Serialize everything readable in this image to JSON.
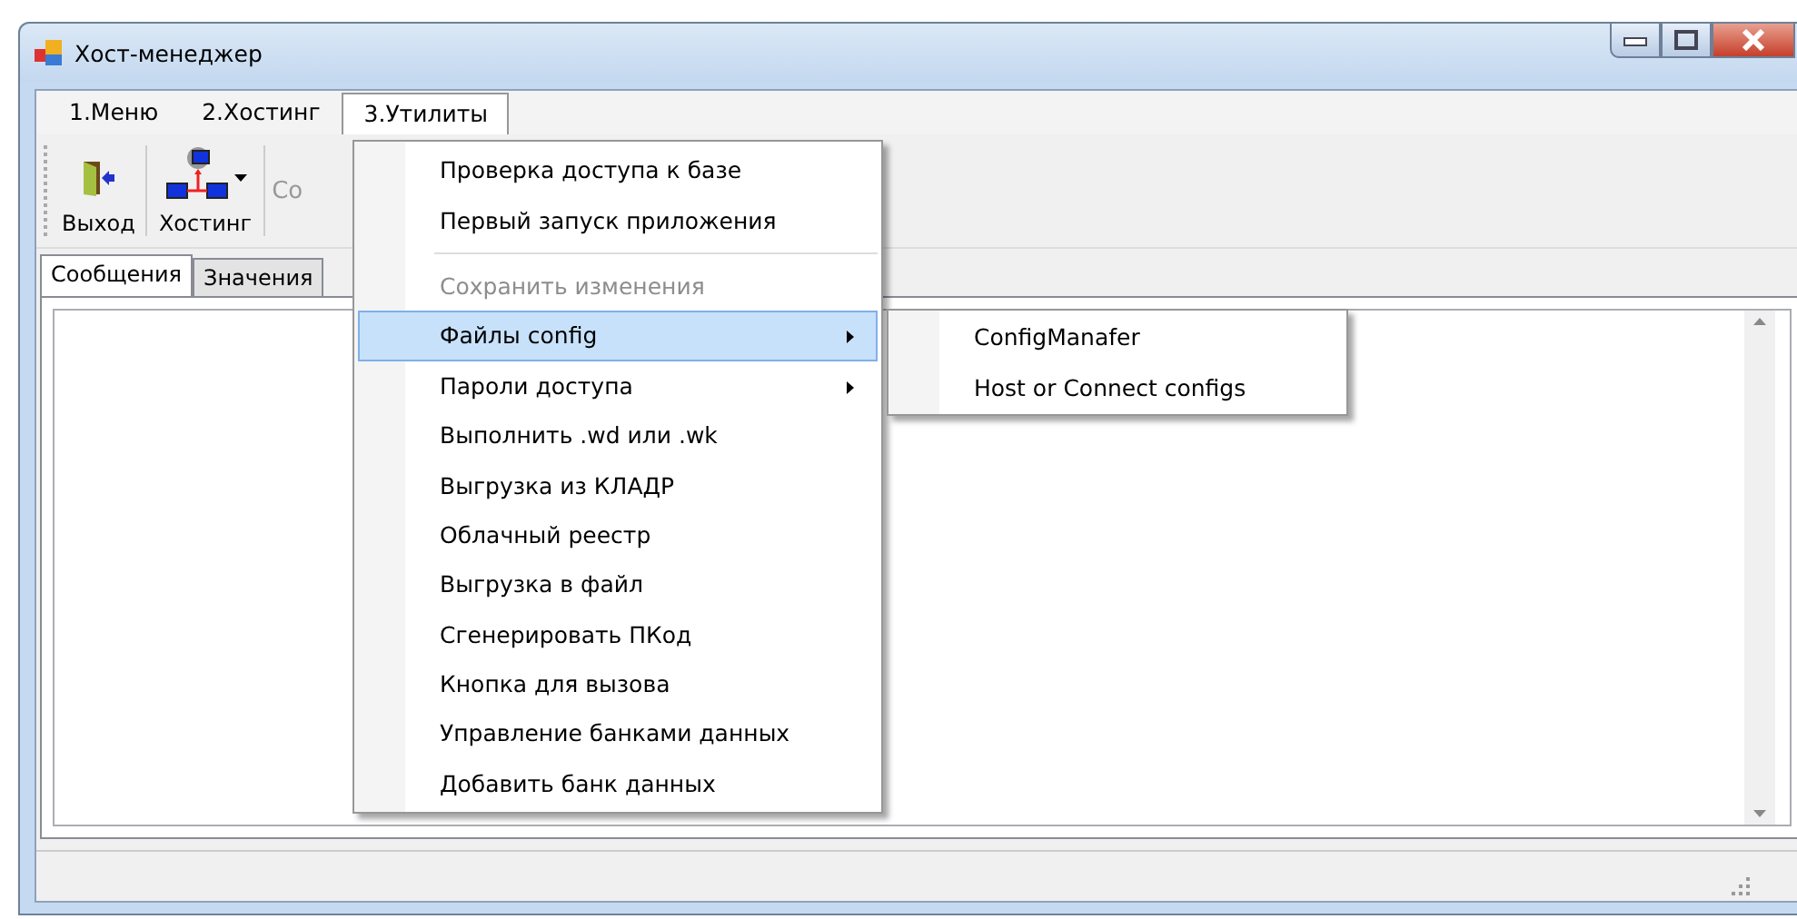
{
  "window": {
    "title": "Хост-менеджер"
  },
  "menu_bar": [
    {
      "label": "1.Меню",
      "selected": false
    },
    {
      "label": "2.Хостинг",
      "selected": false
    },
    {
      "label": "3.Утилиты",
      "selected": true
    }
  ],
  "toolbar": [
    {
      "label": "Выход",
      "kind": "exit",
      "dropdown": false
    },
    {
      "label": "Хостинг",
      "kind": "network",
      "dropdown": true
    },
    {
      "label": "Со",
      "kind": "text"
    }
  ],
  "tabs": [
    {
      "label": "Сообщения",
      "selected": true
    },
    {
      "label": "Значения",
      "selected": false
    }
  ],
  "dropdown_menu": [
    {
      "kind": "item",
      "label": "Проверка доступа к базе",
      "disabled": false,
      "selected": false,
      "submenu": false
    },
    {
      "kind": "item",
      "label": "Первый запуск приложения",
      "disabled": false,
      "selected": false,
      "submenu": false
    },
    {
      "kind": "separator"
    },
    {
      "kind": "item",
      "label": "Сохранить изменения",
      "disabled": true,
      "selected": false,
      "submenu": false
    },
    {
      "kind": "item",
      "label": "Файлы config",
      "disabled": false,
      "selected": true,
      "submenu": true
    },
    {
      "kind": "item",
      "label": "Пароли доступа",
      "disabled": false,
      "selected": false,
      "submenu": true
    },
    {
      "kind": "item",
      "label": "Выполнить .wd или .wk",
      "disabled": false,
      "selected": false,
      "submenu": false
    },
    {
      "kind": "item",
      "label": "Выгрузка из КЛАДР",
      "disabled": false,
      "selected": false,
      "submenu": false
    },
    {
      "kind": "item",
      "label": "Облачный реестр",
      "disabled": false,
      "selected": false,
      "submenu": false
    },
    {
      "kind": "item",
      "label": "Выгрузка в файл",
      "disabled": false,
      "selected": false,
      "submenu": false
    },
    {
      "kind": "item",
      "label": "Сгенерировать ПКод",
      "disabled": false,
      "selected": false,
      "submenu": false
    },
    {
      "kind": "item",
      "label": "Кнопка для вызова",
      "disabled": false,
      "selected": false,
      "submenu": false
    },
    {
      "kind": "item",
      "label": "Управление банками данных",
      "disabled": false,
      "selected": false,
      "submenu": false
    },
    {
      "kind": "item",
      "label": "Добавить банк данных",
      "disabled": false,
      "selected": false,
      "submenu": false
    }
  ],
  "submenu": [
    {
      "label": "ConfigManafer"
    },
    {
      "label": "Host or Connect configs"
    }
  ]
}
